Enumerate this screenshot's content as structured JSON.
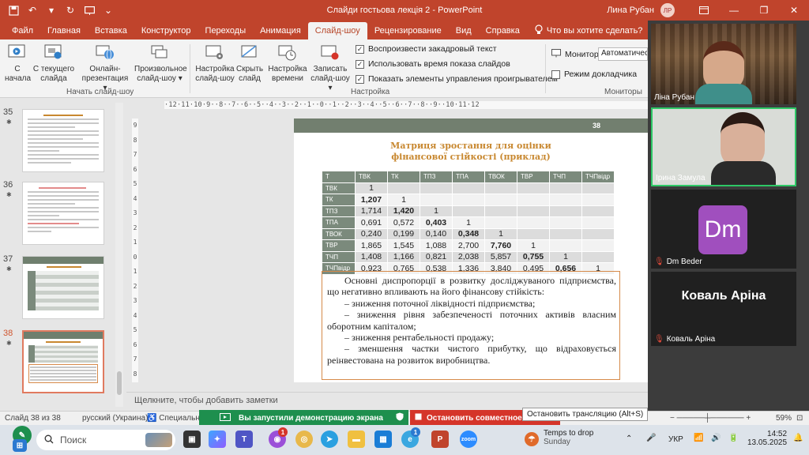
{
  "app": {
    "title": "Слайди гостьова лекція 2  -  PowerPoint",
    "user": "Лина Рубан",
    "user_initials": "ЛР"
  },
  "tabs": [
    "Файл",
    "Главная",
    "Вставка",
    "Конструктор",
    "Переходы",
    "Анимация",
    "Слайд-шоу",
    "Рецензирование",
    "Вид",
    "Справка"
  ],
  "active_tab": "Слайд-шоу",
  "tell_me": "Что вы хотите сделать?",
  "ribbon": {
    "btn_from_start": "С начала",
    "btn_from_current_1": "С текущего",
    "btn_from_current_2": "слайда",
    "btn_online_1": "Онлайн-",
    "btn_online_2": "презентация",
    "btn_custom_1": "Произвольное",
    "btn_custom_2": "слайд-шоу",
    "group_start": "Начать слайд-шоу",
    "btn_setup_1": "Настройка",
    "btn_setup_2": "слайд-шоу",
    "btn_hide_1": "Скрыть",
    "btn_hide_2": "слайд",
    "btn_timing_1": "Настройка",
    "btn_timing_2": "времени",
    "btn_record_1": "Записать",
    "btn_record_2": "слайд-шоу",
    "chk_narration": "Воспроизвести закадровый текст",
    "chk_timings": "Использовать время показа слайдов",
    "chk_controls": "Показать элементы управления проигрывателем",
    "group_setup": "Настройка",
    "monitor_label": "Монитор:",
    "monitor_value": "Автоматически",
    "presenter_view": "Режим докладчика",
    "group_monitors": "Мониторы"
  },
  "thumbnails": [
    {
      "num": "35",
      "star": "✱"
    },
    {
      "num": "36",
      "star": "✱"
    },
    {
      "num": "37",
      "star": "✱"
    },
    {
      "num": "38",
      "star": "✱"
    }
  ],
  "ruler_h": "·12·11·10·9··8··7··6··5··4··3··2··1··0··1··2··3··4··5··6··7··8··9··10·11·12",
  "ruler_v": [
    "9",
    "8",
    "7",
    "6",
    "5",
    "4",
    "3",
    "2",
    "1",
    "0",
    "1",
    "2",
    "3",
    "4",
    "5",
    "6",
    "7",
    "8"
  ],
  "slide": {
    "number": "38",
    "title_1": "Матриця зростання для оцінки",
    "title_2": "фінансової стійкості (приклад)",
    "matrix": {
      "cols": [
        "Т",
        "ТВК",
        "ТК",
        "ТПЗ",
        "ТПА",
        "ТВОК",
        "ТВР",
        "ТЧП",
        "ТЧПвідр"
      ],
      "rows": [
        {
          "h": "ТВК",
          "v": [
            "1",
            "",
            "",
            "",
            "",
            "",
            "",
            ""
          ]
        },
        {
          "h": "ТК",
          "v": [
            "1,207",
            "1",
            "",
            "",
            "",
            "",
            "",
            ""
          ]
        },
        {
          "h": "ТПЗ",
          "v": [
            "1,714",
            "1,420",
            "1",
            "",
            "",
            "",
            "",
            ""
          ]
        },
        {
          "h": "ТПА",
          "v": [
            "0,691",
            "0,572",
            "0,403",
            "1",
            "",
            "",
            "",
            ""
          ]
        },
        {
          "h": "ТВОК",
          "v": [
            "0,240",
            "0,199",
            "0,140",
            "0,348",
            "1",
            "",
            "",
            ""
          ]
        },
        {
          "h": "ТВР",
          "v": [
            "1,865",
            "1,545",
            "1,088",
            "2,700",
            "7,760",
            "1",
            "",
            ""
          ]
        },
        {
          "h": "ТЧП",
          "v": [
            "1,408",
            "1,166",
            "0,821",
            "2,038",
            "5,857",
            "0,755",
            "1",
            ""
          ]
        },
        {
          "h": "ТЧПвідр",
          "v": [
            "0,923",
            "0,765",
            "0,538",
            "1,336",
            "3,840",
            "0,495",
            "0,656",
            "1"
          ]
        }
      ]
    },
    "text": {
      "intro": "Основні диспропорції в розвитку досліджуваного підприємства, що негативно впливають на його фінансову стійкість:",
      "b1": "– зниження поточної ліквідності підприємства;",
      "b2": "– зниження рівня забезпеченості поточних активів власним оборотним капіталом;",
      "b3": "– зниження рентабельності продажу;",
      "b4": "– зменшення частки чистого прибутку, що відраховується реінвестована на розвиток виробництва."
    }
  },
  "notes_placeholder": "Щелкните, чтобы добавить заметки",
  "status": {
    "slide_info": "Слайд 38 из 38",
    "language": "русский (Украина)",
    "special": "Специальные",
    "sharing": "Вы запустили демонстрацию экрана",
    "stop_share": "Остановить совместное испо...",
    "tooltip": "Остановить трансляцию (Alt+S)",
    "zoom": "59%"
  },
  "participants": [
    {
      "name": "Ліна Рубан"
    },
    {
      "name": "Ірина Замула"
    },
    {
      "name": "Dm Beder",
      "initials": "Dm"
    },
    {
      "name": "Коваль Аріна",
      "big": "Коваль Аріна"
    }
  ],
  "taskbar": {
    "search": "Поиск",
    "weather_1": "Temps to drop",
    "weather_2": "Sunday",
    "lang": "УКР",
    "time": "14:52",
    "date": "13.05.2025",
    "badge_messenger": "1",
    "badge_chrome": "1"
  }
}
